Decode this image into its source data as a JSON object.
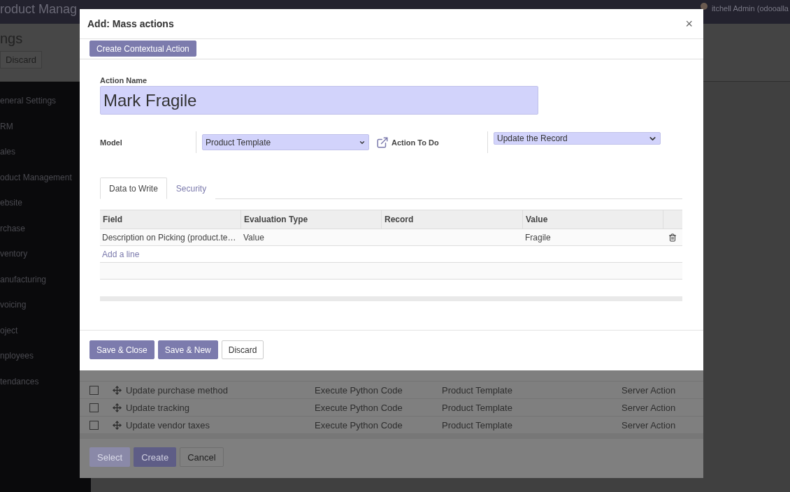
{
  "top_bar": {
    "app_title": "roduct Manag",
    "user": "itchell Admin (odooalla"
  },
  "settings_header": {
    "title": "ngs",
    "discard": "Discard"
  },
  "sidebar": {
    "items": [
      "eneral Settings",
      "RM",
      "ales",
      "oduct Management",
      "ebsite",
      "rchase",
      "ventory",
      "anufacturing",
      "voicing",
      "oject",
      "nployees",
      "tendances"
    ]
  },
  "select_dialog": {
    "rows": [
      {
        "checked": false,
        "name": "Update purchase method",
        "type": "Execute Python Code",
        "model": "Product Template",
        "action_type": "Server Action"
      },
      {
        "checked": false,
        "name": "Update tracking",
        "type": "Execute Python Code",
        "model": "Product Template",
        "action_type": "Server Action"
      },
      {
        "checked": false,
        "name": "Update vendor taxes",
        "type": "Execute Python Code",
        "model": "Product Template",
        "action_type": "Server Action"
      }
    ],
    "buttons": [
      {
        "label": "Select",
        "kind": "primary",
        "disabled": true
      },
      {
        "label": "Create",
        "kind": "primary",
        "disabled": false
      },
      {
        "label": "Cancel",
        "kind": "secondary",
        "disabled": false
      }
    ]
  },
  "dialog": {
    "title": "Add: Mass actions",
    "close": "×",
    "contextual_button": "Create Contextual Action",
    "action_name": {
      "label": "Action Name",
      "value": "Mark Fragile"
    },
    "model": {
      "label": "Model",
      "value": "Product Template"
    },
    "action_to_do": {
      "label": "Action To Do",
      "value": "Update the Record"
    },
    "tabs": [
      {
        "label": "Data to Write",
        "selected": true
      },
      {
        "label": "Security",
        "selected": false
      }
    ],
    "table": {
      "columns": [
        "Field",
        "Evaluation Type",
        "Record",
        "Value"
      ],
      "rows": [
        {
          "field": "Description on Picking (product.te…",
          "evaluation_type": "Value",
          "value": "Fragile"
        }
      ],
      "add_line": "Add a line"
    },
    "buttons": [
      {
        "label": "Save & Close",
        "kind": "primary"
      },
      {
        "label": "Save & New",
        "kind": "primary"
      },
      {
        "label": "Discard",
        "kind": "secondary"
      }
    ]
  }
}
